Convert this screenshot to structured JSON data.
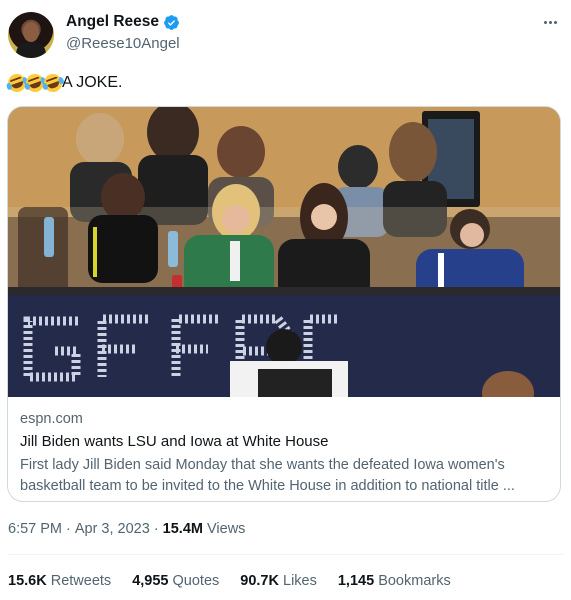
{
  "author": {
    "display_name": "Angel Reese",
    "handle": "@Reese10Angel",
    "verified": true
  },
  "tweet": {
    "emojis": [
      "rolling-on-the-floor-laughing",
      "rolling-on-the-floor-laughing",
      "rolling-on-the-floor-laughing"
    ],
    "text": "A JOKE."
  },
  "link_card": {
    "domain": "espn.com",
    "title": "Jill Biden wants LSU and Iowa at White House",
    "description": "First lady Jill Biden said Monday that she wants the defeated Iowa women's basketball team to be invited to the White House in addition to national title ..."
  },
  "meta": {
    "time": "6:57 PM",
    "date": "Apr 3, 2023",
    "separator": "·",
    "views_count": "15.4M",
    "views_label": "Views"
  },
  "stats": [
    {
      "count": "15.6K",
      "label": "Retweets"
    },
    {
      "count": "4,955",
      "label": "Quotes"
    },
    {
      "count": "90.7K",
      "label": "Likes"
    },
    {
      "count": "1,145",
      "label": "Bookmarks"
    }
  ],
  "colors": {
    "text": "#0f1419",
    "secondary": "#536471",
    "verified": "#1d9bf0",
    "border": "#cfd9de"
  }
}
